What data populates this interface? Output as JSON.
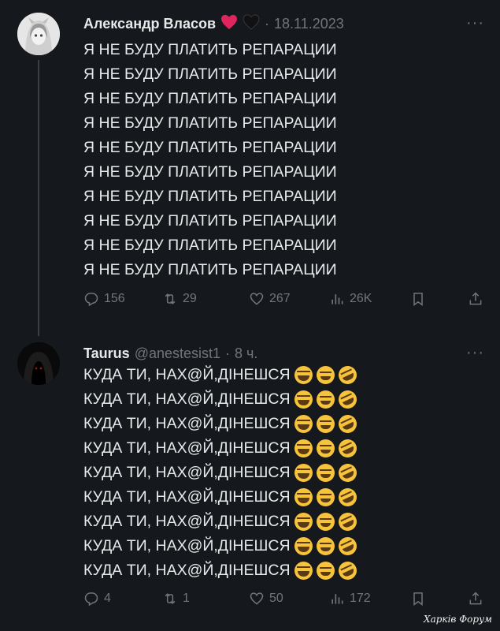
{
  "tweets": [
    {
      "author": "Александр Власов",
      "date": "18.11.2023",
      "separator": "·",
      "more": "···",
      "lines": [
        "Я НЕ БУДУ ПЛАТИТЬ РЕПАРАЦИИ",
        "Я НЕ БУДУ ПЛАТИТЬ РЕПАРАЦИИ",
        "Я НЕ БУДУ ПЛАТИТЬ РЕПАРАЦИИ",
        "Я НЕ БУДУ ПЛАТИТЬ РЕПАРАЦИИ",
        "Я НЕ БУДУ ПЛАТИТЬ РЕПАРАЦИИ",
        "Я НЕ БУДУ ПЛАТИТЬ РЕПАРАЦИИ",
        "Я НЕ БУДУ ПЛАТИТЬ РЕПАРАЦИИ",
        "Я НЕ БУДУ ПЛАТИТЬ РЕПАРАЦИИ",
        "Я НЕ БУДУ ПЛАТИТЬ РЕПАРАЦИИ",
        "Я НЕ БУДУ ПЛАТИТЬ РЕПАРАЦИИ"
      ],
      "stats": {
        "replies": "156",
        "retweets": "29",
        "likes": "267",
        "views": "26K"
      }
    },
    {
      "author": "Taurus",
      "handle": "@anestesist1",
      "time": "8 ч.",
      "separator": "·",
      "more": "···",
      "lines": [
        "КУДА ТИ, НАХ@Й,ДІНЕШСЯ",
        "КУДА ТИ, НАХ@Й,ДІНЕШСЯ",
        "КУДА ТИ, НАХ@Й,ДІНЕШСЯ",
        "КУДА ТИ, НАХ@Й,ДІНЕШСЯ",
        "КУДА ТИ, НАХ@Й,ДІНЕШСЯ",
        "КУДА ТИ, НАХ@Й,ДІНЕШСЯ",
        "КУДА ТИ, НАХ@Й,ДІНЕШСЯ",
        "КУДА ТИ, НАХ@Й,ДІНЕШСЯ",
        "КУДА ТИ, НАХ@Й,ДІНЕШСЯ"
      ],
      "emojis": [
        "face-with-tears-of-joy",
        "grinning-squinting-face",
        "rolling-on-the-floor-laughing"
      ],
      "stats": {
        "replies": "4",
        "retweets": "1",
        "likes": "50",
        "views": "172"
      }
    }
  ],
  "icons": {
    "heart1": "red-heart-icon",
    "heart2": "black-heart-icon",
    "reply": "reply-icon",
    "retweet": "retweet-icon",
    "like": "like-icon",
    "views": "views-icon",
    "bookmark": "bookmark-icon",
    "share": "share-icon"
  },
  "colors": {
    "background": "#15181c",
    "text": "#e7e9ea",
    "muted": "#71767b",
    "red_heart": "#e0245e"
  },
  "watermark": "Харків Форум"
}
